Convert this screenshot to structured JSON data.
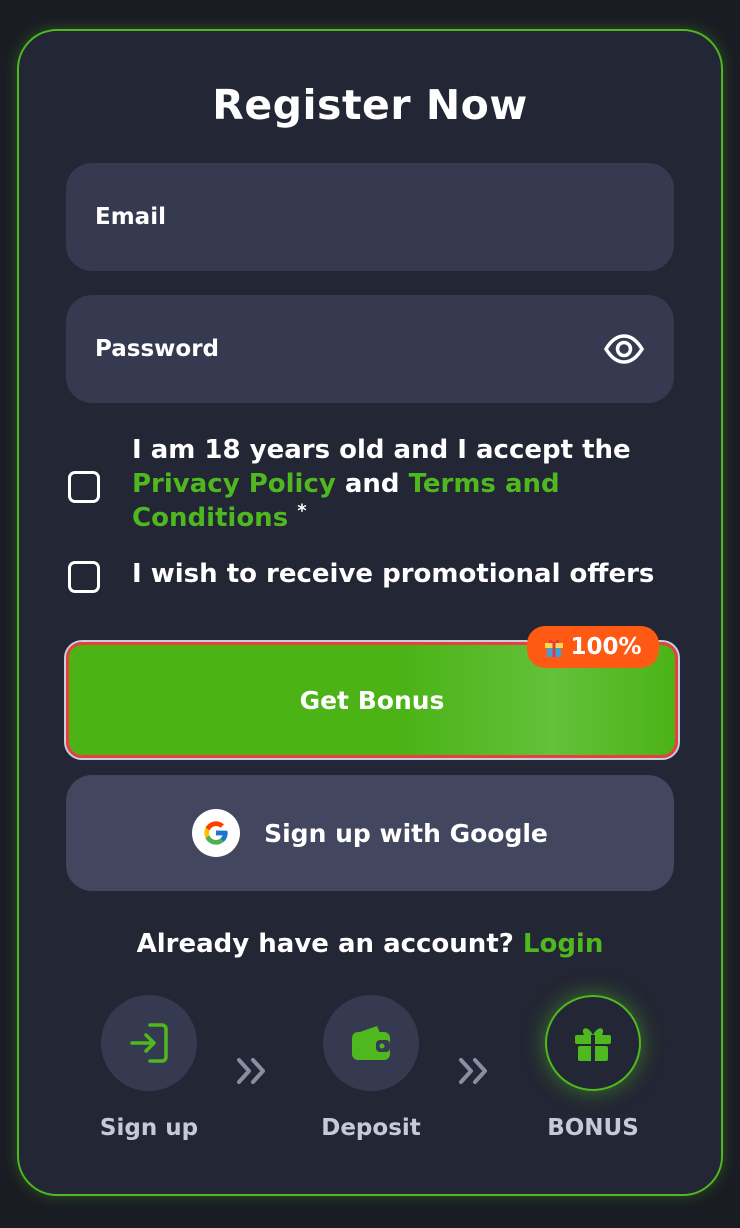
{
  "form": {
    "title": "Register Now",
    "email_placeholder": "Email",
    "password_placeholder": "Password",
    "terms": {
      "text_before": "I am 18 years old and I accept the ",
      "privacy_link": "Privacy Policy",
      "and": " and ",
      "terms_link": "Terms and Conditions",
      "required_mark": "*",
      "checked": false
    },
    "promo": {
      "label": "I wish to receive promotional offers",
      "checked": false
    },
    "bonus_button": {
      "label": "Get Bonus",
      "badge": "100%"
    },
    "google_button": {
      "label": "Sign up with Google"
    },
    "login_prompt": {
      "text": "Already have an account? ",
      "link": "Login"
    }
  },
  "steps": [
    {
      "label": "Sign up",
      "icon": "sign-in-icon"
    },
    {
      "label": "Deposit",
      "icon": "wallet-icon"
    },
    {
      "label": "BONUS",
      "icon": "gift-icon",
      "active": true
    }
  ],
  "colors": {
    "accent": "#4fb81f",
    "card_bg": "#232634",
    "field_bg": "#363a50",
    "badge": "#ff5a14",
    "focus_border": "#e8413c"
  }
}
